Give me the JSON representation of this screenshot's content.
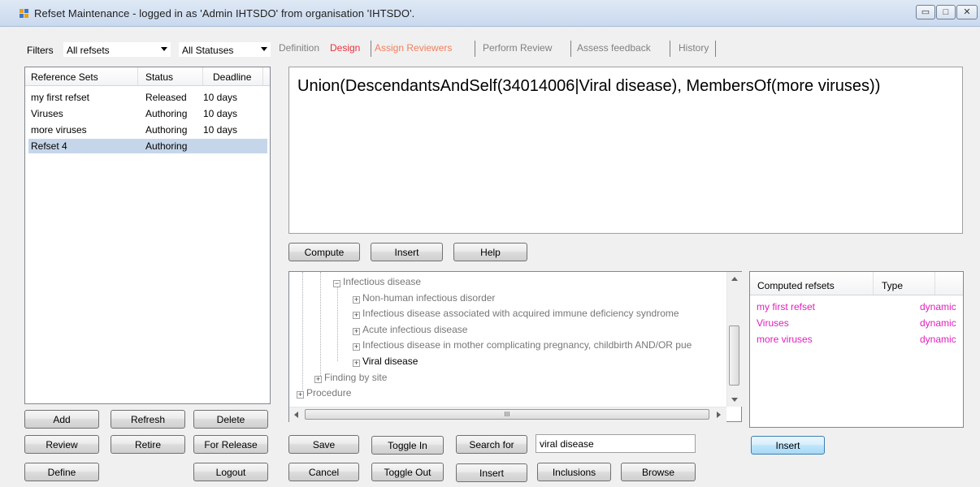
{
  "window": {
    "title": "Refset Maintenance - logged in as 'Admin IHTSDO' from organisation 'IHTSDO'.",
    "controls": [
      "minimize-icon",
      "maximize-icon",
      "close-icon"
    ]
  },
  "filters": {
    "label": "Filters",
    "refset_filter": "All refsets",
    "status_filter": "All Statuses"
  },
  "refset_list": {
    "columns": [
      "Reference Sets",
      "Status",
      "Deadline"
    ],
    "rows": [
      {
        "name": "my first refset",
        "status": "Released",
        "deadline": "10 days"
      },
      {
        "name": "Viruses",
        "status": "Authoring",
        "deadline": "10 days"
      },
      {
        "name": "more viruses",
        "status": "Authoring",
        "deadline": "10 days"
      },
      {
        "name": "Refset 4",
        "status": "Authoring",
        "deadline": ""
      }
    ],
    "selected_row": "Refset 4"
  },
  "left_buttons": {
    "add": "Add",
    "refresh": "Refresh",
    "delete": "Delete",
    "review": "Review",
    "retire": "Retire",
    "for_release": "For Release",
    "define": "Define",
    "logout": "Logout"
  },
  "tabs": [
    {
      "label": "Definition",
      "state": "inactive"
    },
    {
      "label": "Design",
      "state": "active"
    },
    {
      "label": "Assign Reviewers",
      "state": "highlight"
    },
    {
      "label": "Perform Review",
      "state": "inactive"
    },
    {
      "label": "Assess feedback",
      "state": "inactive"
    },
    {
      "label": "History",
      "state": "inactive"
    }
  ],
  "design": {
    "expression": "Union(DescendantsAndSelf(34014006|Viral disease), MembersOf(more viruses))",
    "compute": "Compute",
    "insert": "Insert",
    "help": "Help"
  },
  "concept_tree": {
    "items": [
      {
        "label": "Infectious disease",
        "expander": "−",
        "level": 1,
        "dark": false
      },
      {
        "label": "Non-human infectious disorder",
        "expander": "+",
        "level": 2,
        "dark": false
      },
      {
        "label": "Infectious disease associated with acquired immune deficiency syndrome",
        "expander": "+",
        "level": 2,
        "dark": false
      },
      {
        "label": "Acute infectious disease",
        "expander": "+",
        "level": 2,
        "dark": false
      },
      {
        "label": "Infectious disease in mother complicating pregnancy, childbirth AND/OR pue",
        "expander": "+",
        "level": 2,
        "dark": false
      },
      {
        "label": "Viral disease",
        "expander": "+",
        "level": 2,
        "dark": true
      },
      {
        "label": "Finding by site",
        "expander": "+",
        "level": 0.5,
        "dark": false
      },
      {
        "label": "Procedure",
        "expander": "+",
        "level": 0,
        "dark": false
      }
    ],
    "hscroll_grip": "III"
  },
  "computed_refsets": {
    "columns": [
      "Computed refsets",
      "Type"
    ],
    "rows": [
      {
        "name": "my first refset",
        "type": "dynamic"
      },
      {
        "name": "Viruses",
        "type": "dynamic"
      },
      {
        "name": "more viruses",
        "type": "dynamic"
      }
    ],
    "insert": "Insert",
    "accent": "#e01fbd"
  },
  "bottom_buttons": {
    "save": "Save",
    "toggle_in": "Toggle In",
    "search_for": "Search for",
    "search_value": "viral disease",
    "cancel": "Cancel",
    "toggle_out": "Toggle Out",
    "insert": "Insert",
    "inclusions": "Inclusions",
    "browse": "Browse"
  }
}
